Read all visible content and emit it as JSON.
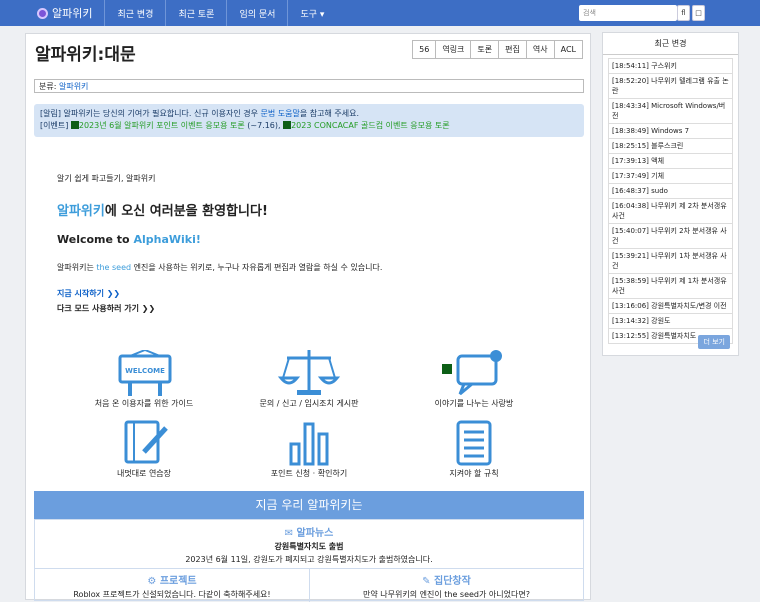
{
  "nav": {
    "brand": "알파위키",
    "items": [
      "최근 변경",
      "최근 토론",
      "임의 문서",
      "도구 ▾"
    ],
    "search_placeholder": "검색",
    "search_go": "fl",
    "search_btn2": "□"
  },
  "page": {
    "title": "알파위키:대문",
    "buttons": [
      "56",
      "역링크",
      "토론",
      "편집",
      "역사",
      "ACL"
    ],
    "category_label": "분류:",
    "category_value": "알파위키"
  },
  "notice": {
    "line1_tag": "[알림]",
    "line1_pre": " 알파위키는 당신의 기여가 필요합니다. 신규 이용자인 경우 ",
    "line1_link": "문법 도움말",
    "line1_post": "을 참고해 주세요.",
    "line2_tag": "[이벤트]",
    "line2_ev1": "2023년 6월 알파위키 포인트 이벤트 응모용 토론",
    "line2_mid": " (~7.16), ",
    "line2_ev2": "2023 CONCACAF 골드컵 이벤트 응모용 토론"
  },
  "intro": {
    "slogan": "알기 쉽게 파고들기, 알파위키",
    "welcome_blue": "알파위키",
    "welcome_rest": "에 오신 여러분을 환영합니다!",
    "welcome_en_pre": "Welcome to ",
    "welcome_en_blue": "AlphaWiki!",
    "desc_pre": "알파위키는 ",
    "desc_link": "the seed",
    "desc_post": " 엔진을 사용하는 위키로, 누구나 자유롭게 편집과 열람을 하실 수 있습니다.",
    "start": "지금 시작하기 ❯❯",
    "dark": "다크 모드 사용하러 가기 ❯❯"
  },
  "features": [
    {
      "icon": "welcome-sign-icon",
      "label": "처음 온 이용자를 위한 가이드",
      "sign_text": "WELCOME"
    },
    {
      "icon": "scales-icon",
      "label": "문의 / 신고 / 임시조치 게시판"
    },
    {
      "icon": "chat-bubble-icon",
      "label": "이야기를 나누는 사랑방"
    },
    {
      "icon": "notebook-pen-icon",
      "label": "내멋대로 연습장"
    },
    {
      "icon": "bar-chart-icon",
      "label": "포인트 신청 · 확인하기"
    },
    {
      "icon": "rules-document-icon",
      "label": "지켜야 할 규칙"
    }
  ],
  "banner": "지금 우리 알파위키는",
  "news": {
    "head": "알파뉴스",
    "headline": "강원특별자치도 출범",
    "text": "2023년 6월 11일, 강원도가 폐지되고 강원특별자치도가 출범하였습니다.",
    "left_head": "프로젝트",
    "left_text": "Roblox 프로젝트가 신설되었습니다. 다같이 축하해주세요!",
    "right_head": "집단창작",
    "right_text": "만약 나무위키의 엔진이 the seed가 아니었다면?"
  },
  "sidebar": {
    "title": "최근 변경",
    "items": [
      "[18:54:11] 구스위키",
      "[18:52:20] 나무위키 텔레그램 유출 논란",
      "[18:43:34] Microsoft Windows/버전",
      "[18:38:49] Windows 7",
      "[18:25:15] 블루스크린",
      "[17:39:13] 액체",
      "[17:37:49] 기체",
      "[16:48:37] sudo",
      "[16:04:38] 나무위키 제 2차 분서갱유 사건",
      "[15:40:07] 나무위키 2차 분서갱유 사건",
      "[15:39:21] 나무위키 1차 분서갱유 사건",
      "[15:38:59] 나무위키 제 1차 분서갱유 사건",
      "[13:16:06] 강원특별자치도/변경 이전",
      "[13:14:32] 강원도",
      "[13:12:55] 강원특별자치도"
    ],
    "more": "더 보기"
  },
  "colors": {
    "nav": "#3d6ec5",
    "accent": "#6b9ede",
    "link": "#0b5fc7"
  }
}
